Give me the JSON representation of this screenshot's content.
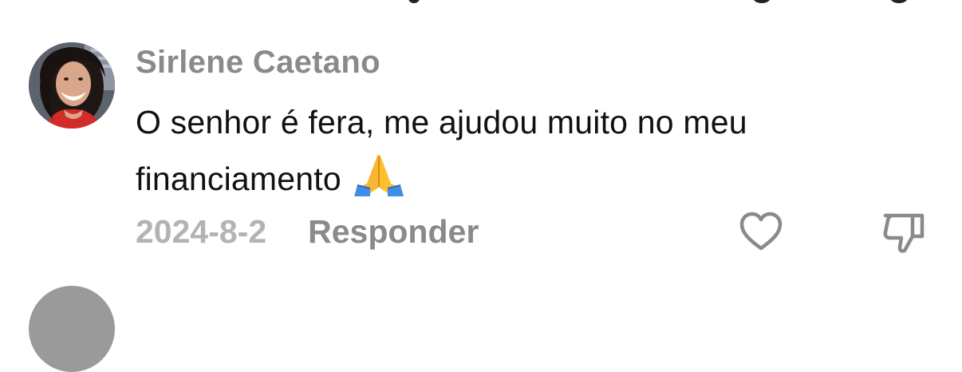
{
  "comment": {
    "author": "Sirlene Caetano",
    "text": "O senhor é fera, me ajudou muito no meu financiamento",
    "emoji": "🙏",
    "date": "2024-8-2",
    "reply_label": "Responder"
  },
  "icons": {
    "like": "heart-outline-icon",
    "dislike": "thumbs-down-outline-icon",
    "emoji": "folded-hands-icon"
  },
  "colors": {
    "author": "#8a8a8a",
    "text": "#111111",
    "date": "#b3b3b3",
    "reply": "#8a8a8a",
    "icon_stroke": "#8a8a8a"
  }
}
